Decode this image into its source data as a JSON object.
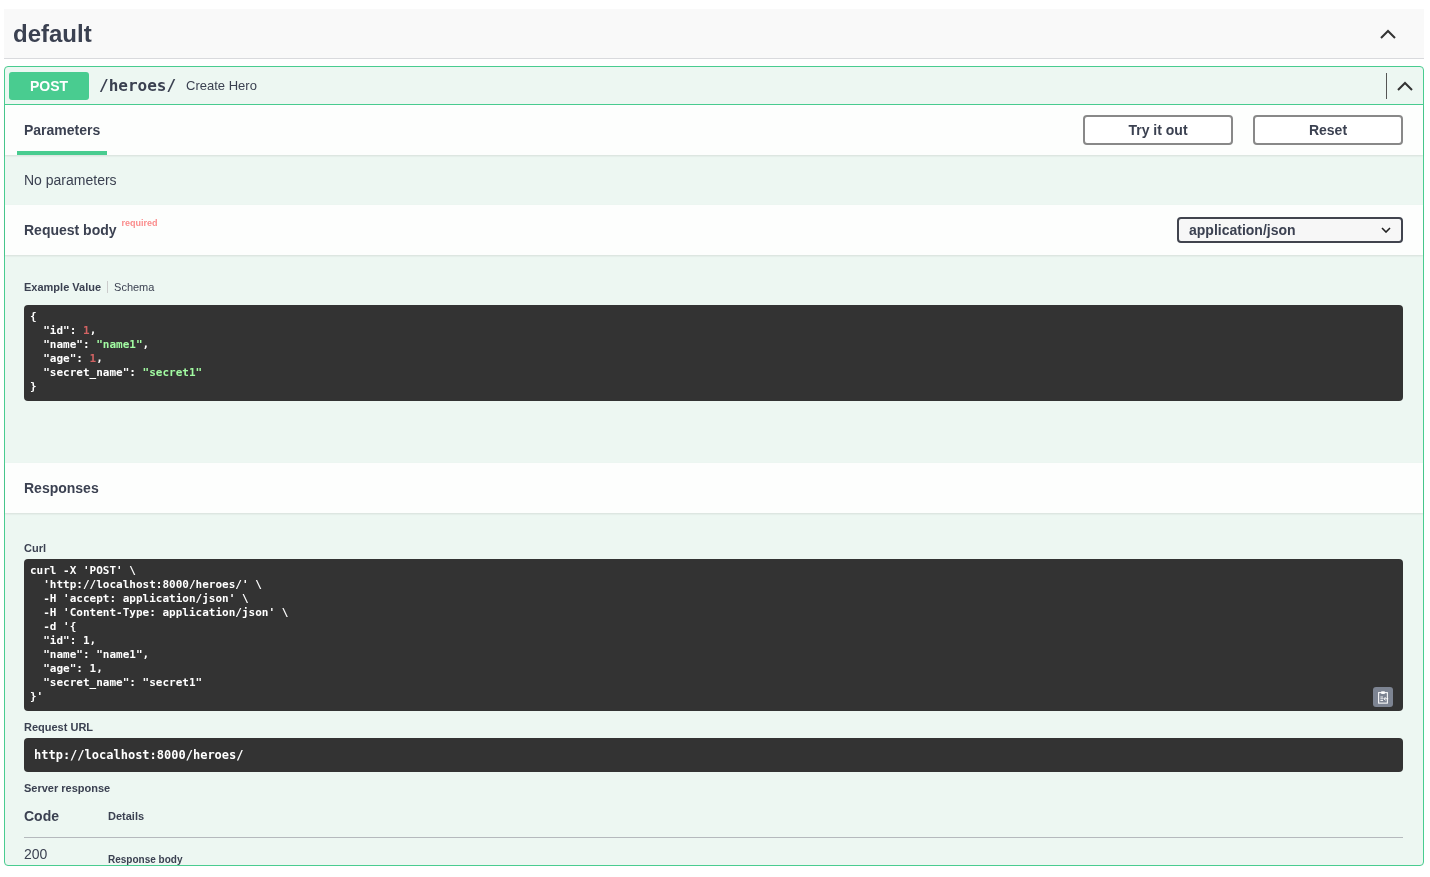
{
  "section": {
    "title": "default",
    "expanded": true
  },
  "operation": {
    "method": "POST",
    "path": "/heroes/",
    "summary": "Create Hero",
    "expanded": true
  },
  "tabs": [
    {
      "label": "Parameters",
      "selected": true
    }
  ],
  "buttons": [
    "Try it out",
    "Reset"
  ],
  "no_parameters": "No parameters",
  "request_body": {
    "title": "Request body",
    "required_label": "required",
    "content_type": "application/json"
  },
  "example_tabs": [
    {
      "label": "Example Value",
      "selected": true
    },
    {
      "label": "Schema",
      "selected": false
    }
  ],
  "example_lines": [
    [
      {
        "text": "{",
        "kind": "punct"
      }
    ],
    [
      {
        "text": "  \"id\"",
        "kind": "key"
      },
      {
        "text": ": ",
        "kind": "punct"
      },
      {
        "text": "1",
        "kind": "number"
      },
      {
        "text": ",",
        "kind": "punct"
      }
    ],
    [
      {
        "text": "  \"name\"",
        "kind": "key"
      },
      {
        "text": ": ",
        "kind": "punct"
      },
      {
        "text": "\"name1\"",
        "kind": "string"
      },
      {
        "text": ",",
        "kind": "punct"
      }
    ],
    [
      {
        "text": "  \"age\"",
        "kind": "key"
      },
      {
        "text": ": ",
        "kind": "punct"
      },
      {
        "text": "1",
        "kind": "number"
      },
      {
        "text": ",",
        "kind": "punct"
      }
    ],
    [
      {
        "text": "  \"secret_name\"",
        "kind": "key"
      },
      {
        "text": ": ",
        "kind": "punct"
      },
      {
        "text": "\"secret1\"",
        "kind": "string"
      }
    ],
    [
      {
        "text": "}",
        "kind": "punct"
      }
    ]
  ],
  "responses_title": "Responses",
  "curl": {
    "label": "Curl",
    "lines": [
      "curl -X 'POST' \\",
      "  'http://localhost:8000/heroes/' \\",
      "  -H 'accept: application/json' \\",
      "  -H 'Content-Type: application/json' \\",
      "  -d '{",
      "  \"id\": 1,",
      "  \"name\": \"name1\",",
      "  \"age\": 1,",
      "  \"secret_name\": \"secret1\"",
      "}'"
    ]
  },
  "request_url": {
    "label": "Request URL",
    "value": "http://localhost:8000/heroes/"
  },
  "server_response": {
    "label": "Server response",
    "columns": [
      "Code",
      "Details"
    ],
    "rows": [
      {
        "code": "200",
        "details_label": "Response body"
      }
    ]
  }
}
